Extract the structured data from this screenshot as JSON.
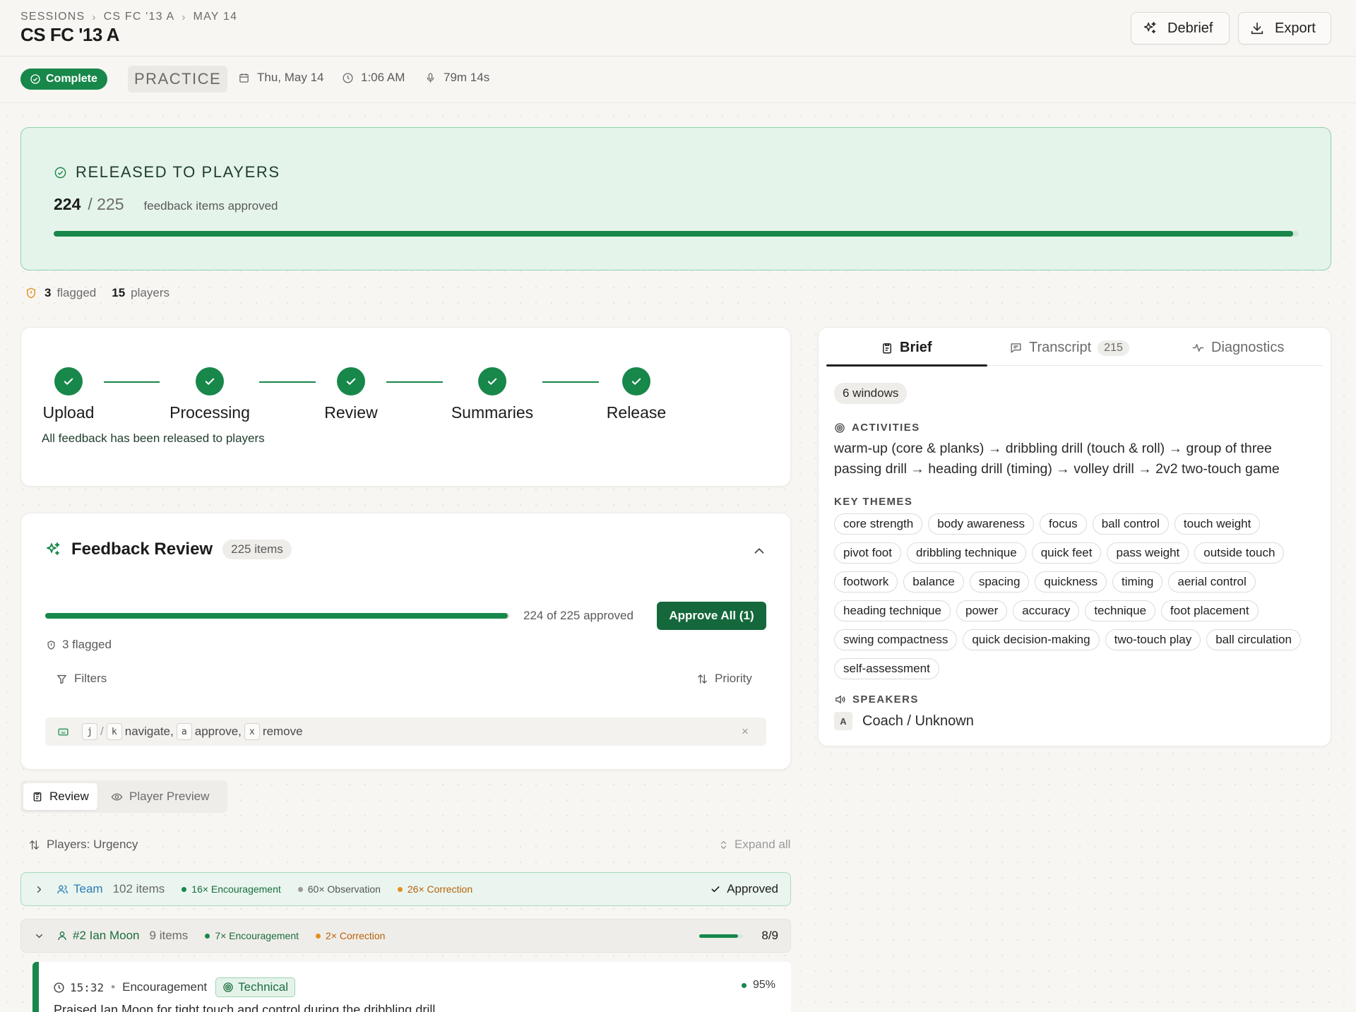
{
  "header": {
    "breadcrumb": [
      "SESSIONS",
      "CS FC '13 A",
      "MAY 14"
    ],
    "title": "CS FC '13 A",
    "debrief_label": "Debrief",
    "export_label": "Export"
  },
  "meta": {
    "status": "Complete",
    "session_type": "PRACTICE",
    "date": "Thu, May 14",
    "time": "1:06 AM",
    "duration": "79m 14s"
  },
  "released": {
    "title": "RELEASED TO PLAYERS",
    "approved": "224",
    "total": "/ 225",
    "label": "feedback items approved",
    "progress": 0.9956
  },
  "stats": {
    "flagged_count": "3",
    "flagged_label": "flagged",
    "players_count": "15",
    "players_label": "players"
  },
  "pipeline": {
    "steps": [
      "Upload",
      "Processing",
      "Review",
      "Summaries",
      "Release"
    ],
    "note": "All feedback has been released to players"
  },
  "feedback_review": {
    "title": "Feedback Review",
    "items_badge": "225 items",
    "approved_text": "224 of 225 approved",
    "progress": 0.9956,
    "approve_all_label": "Approve All (1)",
    "flagged_text": "3 flagged",
    "filters_label": "Filters",
    "priority_label": "Priority",
    "shortcuts": {
      "k1": "j",
      "k2": "k",
      "t1": "navigate,",
      "k3": "a",
      "t2": "approve,",
      "k4": "x",
      "t3": "remove"
    },
    "close_glyph": "×"
  },
  "view_tabs": {
    "review": "Review",
    "player_preview": "Player Preview"
  },
  "players": {
    "sort_label": "Players: Urgency",
    "expand_all": "Expand all",
    "rows": [
      {
        "name": "Team",
        "count": "102 items",
        "encouragement": "16× Encouragement",
        "observation": "60× Observation",
        "correction": "26× Correction",
        "status": "Approved"
      },
      {
        "name": "#2 Ian Moon",
        "count": "9 items",
        "encouragement": "7× Encouragement",
        "correction": "2× Correction",
        "progress": 0.889,
        "progress_text": "8/9"
      }
    ]
  },
  "feedback_item": {
    "time": "15:32",
    "type": "Encouragement",
    "category": "Technical",
    "confidence": "95%",
    "text": "Praised Ian Moon for tight touch and control during the dribbling drill."
  },
  "right_panel": {
    "tabs": {
      "brief": "Brief",
      "transcript": "Transcript",
      "transcript_count": "215",
      "diagnostics": "Diagnostics"
    },
    "windows": "6 windows",
    "activities_heading": "ACTIVITIES",
    "activities": "warm-up (core & planks) → dribbling drill (touch & roll) → group of three passing drill → heading drill (timing) → volley drill → 2v2 two-touch game",
    "themes_heading": "KEY THEMES",
    "themes": [
      "core strength",
      "body awareness",
      "focus",
      "ball control",
      "touch weight",
      "pivot foot",
      "dribbling technique",
      "quick feet",
      "pass weight",
      "outside touch",
      "footwork",
      "balance",
      "spacing",
      "quickness",
      "timing",
      "aerial control",
      "heading technique",
      "power",
      "accuracy",
      "technique",
      "foot placement",
      "swing compactness",
      "quick decision-making",
      "two-touch play",
      "ball circulation",
      "self-assessment"
    ],
    "speakers_heading": "SPEAKERS",
    "speaker_initial": "A",
    "speaker_name": "Coach / Unknown"
  },
  "colors": {
    "accent": "#18874a",
    "accent_dark": "#14683b",
    "correction": "#e58e1f",
    "observation": "#9a9a9a"
  }
}
